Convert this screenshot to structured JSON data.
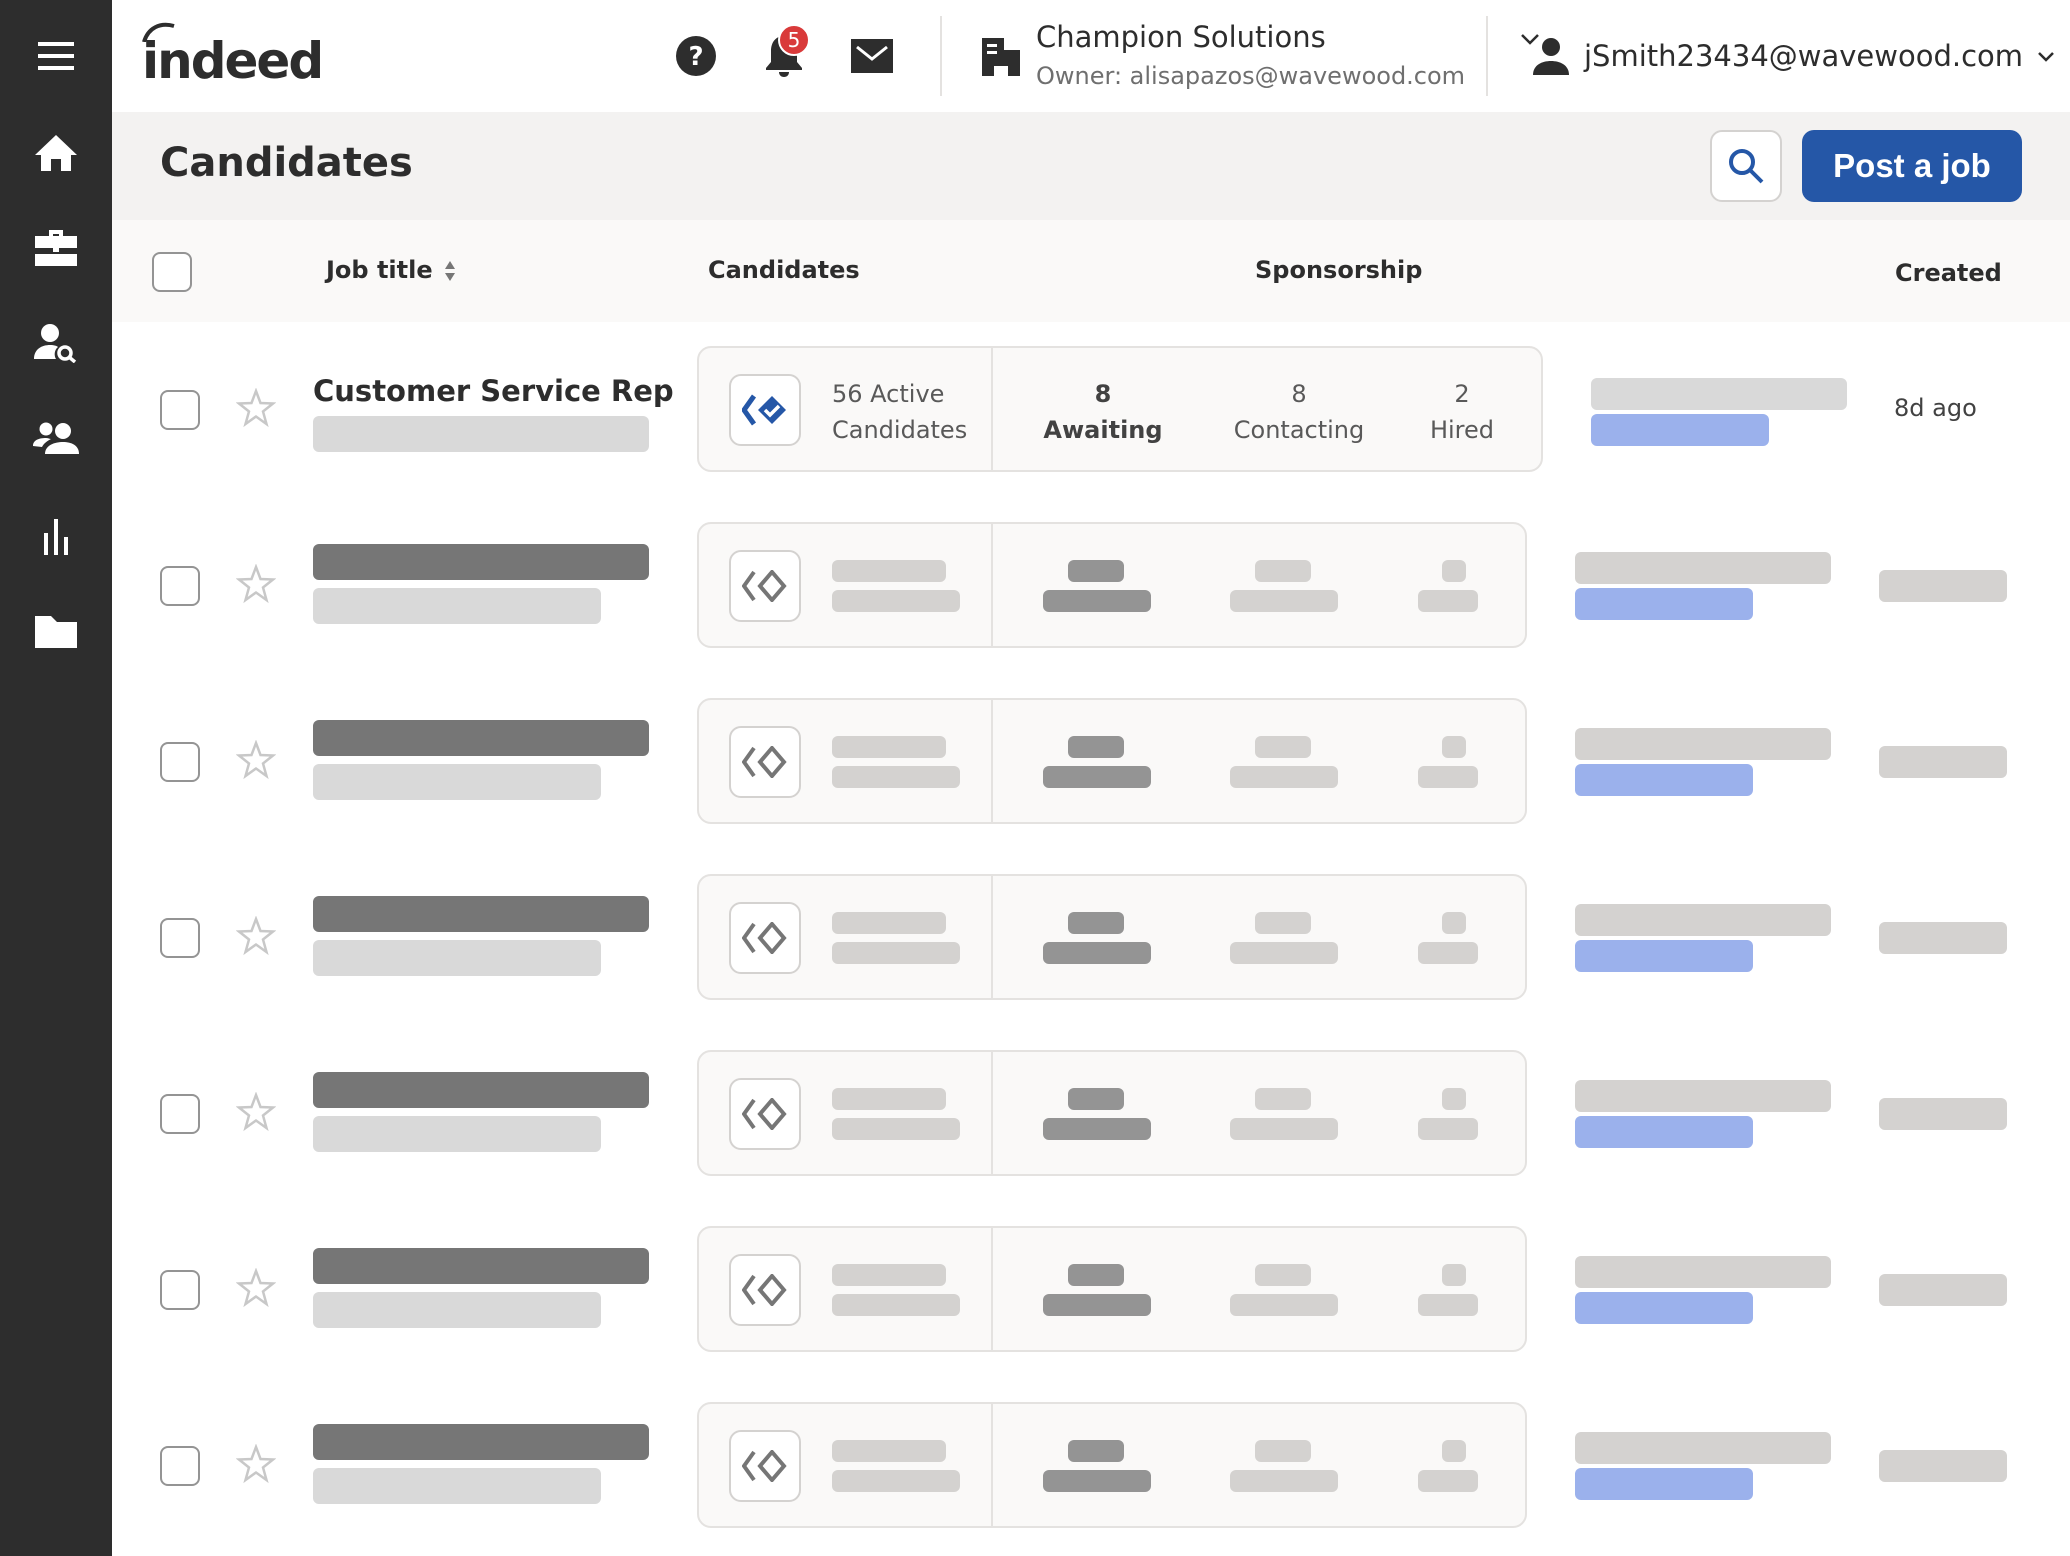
{
  "sidebar": {
    "items": [
      {
        "name": "menu",
        "icon": "hamburger-menu-icon"
      },
      {
        "name": "home",
        "icon": "home-icon"
      },
      {
        "name": "jobs",
        "icon": "briefcase-icon"
      },
      {
        "name": "find-candidates",
        "icon": "person-search-icon"
      },
      {
        "name": "candidates",
        "icon": "people-icon"
      },
      {
        "name": "analytics",
        "icon": "bar-chart-icon"
      },
      {
        "name": "documents",
        "icon": "folder-icon"
      }
    ]
  },
  "header": {
    "logo_text": "indeed",
    "help_icon": "question-icon",
    "notifications": {
      "icon": "bell-icon",
      "count": "5"
    },
    "messages_icon": "mail-icon",
    "company": {
      "name": "Champion Solutions",
      "owner": "Owner: alisapazos@wavewood.com",
      "icon": "building-icon"
    },
    "account": {
      "email": "jSmith23434@wavewood.com",
      "icon": "person-icon"
    }
  },
  "titlebar": {
    "title": "Candidates",
    "search_icon": "search-icon",
    "post_job_label": "Post a job"
  },
  "table": {
    "columns": {
      "job_title": "Job title",
      "candidates": "Candidates",
      "sponsorship": "Sponsorship",
      "created": "Created"
    },
    "rows": [
      {
        "title": "Customer Service Rep",
        "active_line1": "56 Active",
        "active_line2": "Candidates",
        "awaiting_count": "8",
        "awaiting_label": "Awaiting",
        "contacting_count": "8",
        "contacting_label": "Contacting",
        "hired_count": "2",
        "hired_label": "Hired",
        "created": "8d ago",
        "loaded": true
      },
      {
        "loaded": false
      },
      {
        "loaded": false
      },
      {
        "loaded": false
      },
      {
        "loaded": false
      },
      {
        "loaded": false
      },
      {
        "loaded": false
      }
    ]
  },
  "colors": {
    "sidebar_bg": "#2d2d2d",
    "brand_blue": "#2557a7",
    "badge_red": "#d93a3a",
    "sponsor_placeholder_blue": "#9bb1ec"
  }
}
